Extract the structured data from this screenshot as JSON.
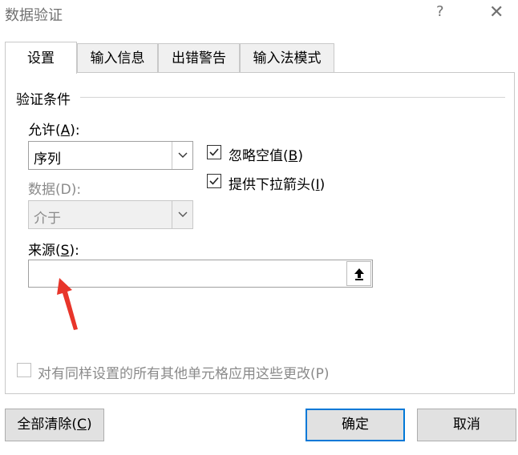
{
  "window": {
    "title": "数据验证",
    "help": "?",
    "close": "✕"
  },
  "tabs": [
    {
      "label": "设置",
      "active": true
    },
    {
      "label": "输入信息",
      "active": false
    },
    {
      "label": "出错警告",
      "active": false
    },
    {
      "label": "输入法模式",
      "active": false
    }
  ],
  "settings": {
    "group_label": "验证条件",
    "allow": {
      "prefix": "允许(",
      "key": "A",
      "suffix": "):",
      "value": "序列"
    },
    "data": {
      "label": "数据(D):",
      "value": "介于"
    },
    "ignore_blank": {
      "prefix": "忽略空值(",
      "key": "B",
      "suffix": ")",
      "checked": true
    },
    "dropdown": {
      "prefix": "提供下拉箭头(",
      "key": "I",
      "suffix": ")",
      "checked": true
    },
    "source": {
      "prefix": "来源(",
      "key": "S",
      "suffix": "):",
      "value": ""
    },
    "apply_all": {
      "label": "对有同样设置的所有其他单元格应用这些更改(P)",
      "checked": false
    }
  },
  "buttons": {
    "clear_all": {
      "prefix": "全部清除(",
      "key": "C",
      "suffix": ")"
    },
    "ok": "确定",
    "cancel": "取消"
  },
  "colors": {
    "annotation_arrow": "#e8352a",
    "default_button_border": "#0078d7"
  }
}
